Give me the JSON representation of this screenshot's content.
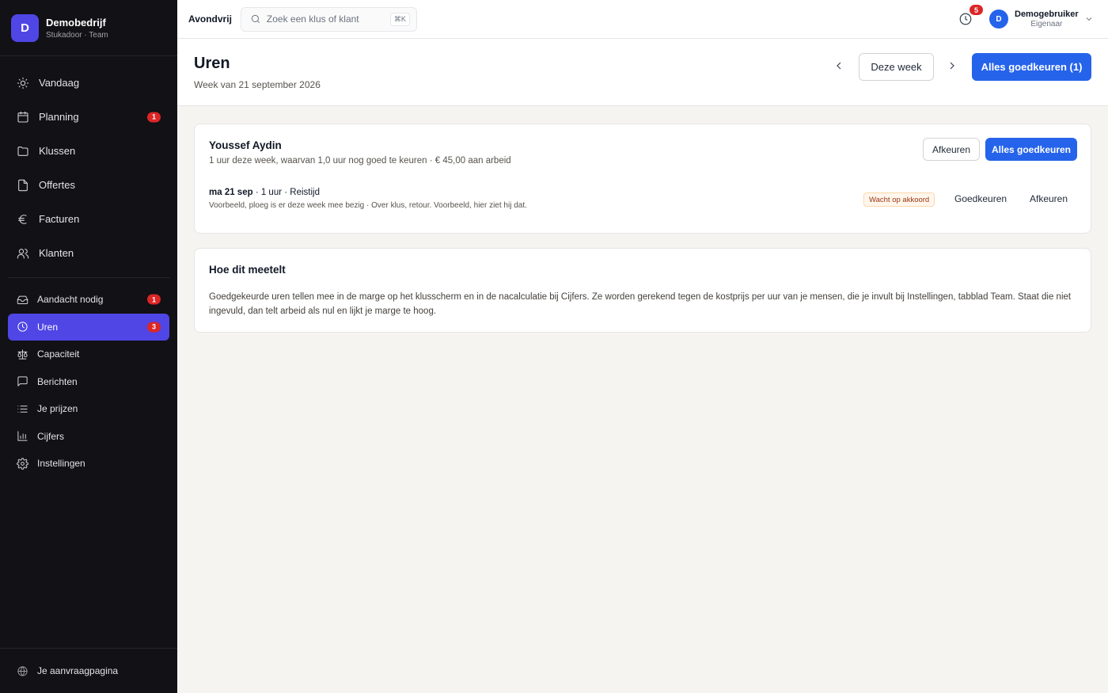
{
  "brand": {
    "initial": "D",
    "name": "Demobedrijf",
    "subtitle": "Stukadoor · Team"
  },
  "sidebar": {
    "main_items": [
      {
        "label": "Vandaag",
        "icon": "sun-icon"
      },
      {
        "label": "Planning",
        "icon": "calendar-icon",
        "badge": "1"
      },
      {
        "label": "Klussen",
        "icon": "folder-icon"
      },
      {
        "label": "Offertes",
        "icon": "document-icon"
      },
      {
        "label": "Facturen",
        "icon": "euro-icon"
      },
      {
        "label": "Klanten",
        "icon": "users-icon"
      }
    ],
    "secondary_items": [
      {
        "label": "Aandacht nodig",
        "icon": "inbox-icon",
        "badge": "1"
      },
      {
        "label": "Uren",
        "icon": "clock-icon",
        "badge": "3",
        "active": true
      },
      {
        "label": "Capaciteit",
        "icon": "scale-icon"
      },
      {
        "label": "Berichten",
        "icon": "message-icon"
      },
      {
        "label": "Je prijzen",
        "icon": "list-icon"
      },
      {
        "label": "Cijfers",
        "icon": "bar-chart-icon"
      },
      {
        "label": "Instellingen",
        "icon": "gear-icon"
      }
    ],
    "footer": {
      "label": "Je aanvraagpagina",
      "icon": "globe-icon"
    }
  },
  "topbar": {
    "company": "Avondvrij",
    "search": {
      "placeholder": "Zoek een klus of klant",
      "shortcut": "⌘K"
    },
    "notifications_count": "5",
    "user": {
      "initial": "D",
      "name": "Demogebruiker",
      "role": "Eigenaar"
    }
  },
  "header": {
    "title": "Uren",
    "subtitle": "Week van 21 september 2026",
    "week_button": "Deze week",
    "approve_all_button": "Alles goedkeuren (1)"
  },
  "employee_card": {
    "name": "Youssef Aydin",
    "summary": "1 uur deze week, waarvan 1,0 uur nog goed te keuren · € 45,00 aan arbeid",
    "reject_all": "Afkeuren",
    "approve_all": "Alles goedkeuren",
    "entry": {
      "date": "ma 21 sep",
      "details": " · 1 uur · Reistijd",
      "description": "Voorbeeld, ploeg is er deze week mee bezig · Over klus, retour. Voorbeeld, hier ziet hij dat.",
      "status": "Wacht op akkoord",
      "approve": "Goedkeuren",
      "reject": "Afkeuren"
    }
  },
  "info_card": {
    "title": "Hoe dit meetelt",
    "body": "Goedgekeurde uren tellen mee in de marge op het klusscherm en in de nacalculatie bij Cijfers. Ze worden gerekend tegen de kostprijs per uur van je mensen, die je invult bij Instellingen, tabblad Team. Staat die niet ingevuld, dan telt arbeid als nul en lijkt je marge te hoog."
  },
  "colors": {
    "accent": "#2563eb",
    "sidebar_active": "#4f46e5",
    "sidebar_bg": "#111116",
    "badge": "#dc2626"
  }
}
